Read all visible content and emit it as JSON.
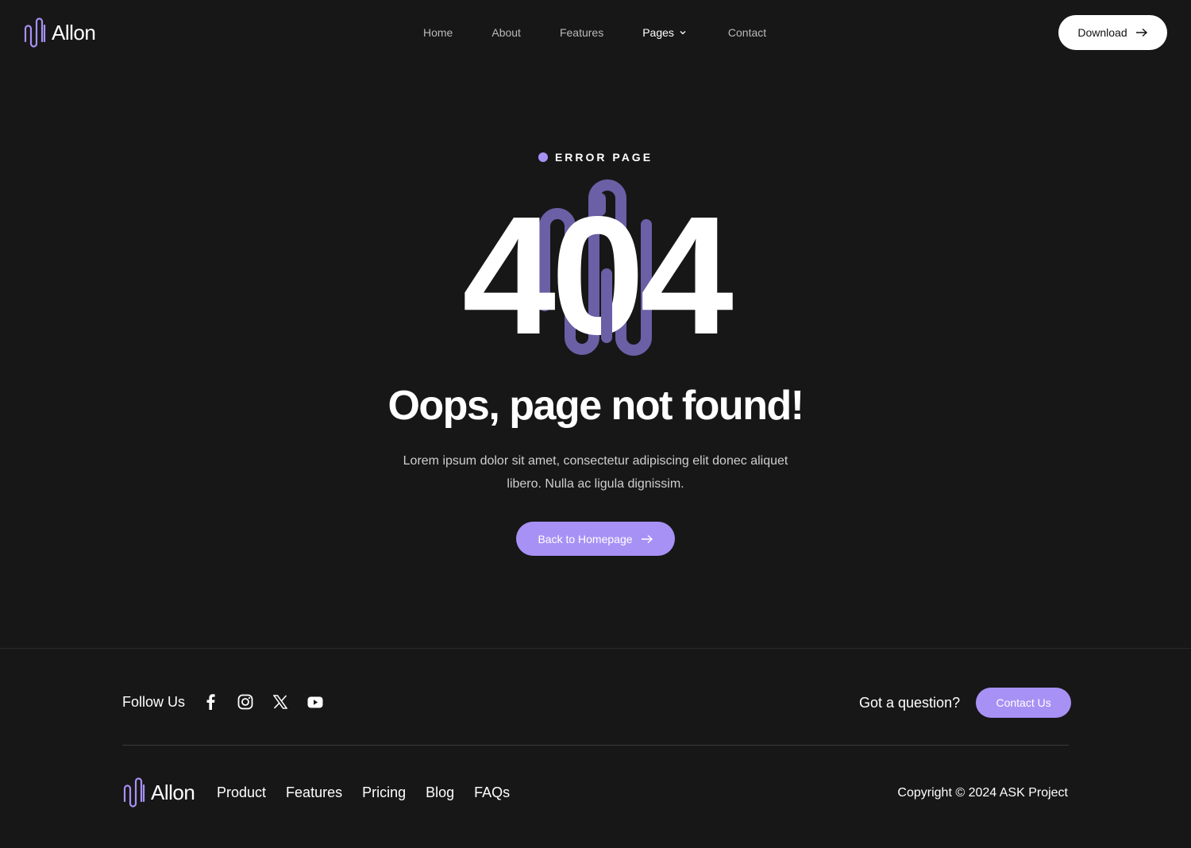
{
  "brand": {
    "name": "Allon",
    "logo_icon": "wave-logo-icon",
    "accent": "#a891f5"
  },
  "header": {
    "nav": [
      {
        "label": "Home"
      },
      {
        "label": "About"
      },
      {
        "label": "Features"
      },
      {
        "label": "Pages",
        "icon": "chevron-down-icon"
      },
      {
        "label": "Contact"
      }
    ],
    "download_label": "Download"
  },
  "hero": {
    "eyebrow": "ERROR PAGE",
    "code": "404",
    "headline": "Oops, page not found!",
    "description": "Lorem ipsum dolor sit amet, consectetur adipiscing elit donec aliquet libero. Nulla ac ligula dignissim.",
    "cta_label": "Back to Homepage"
  },
  "footer": {
    "follow_label": "Follow Us",
    "social_icons": [
      "facebook-icon",
      "instagram-icon",
      "x-icon",
      "youtube-icon"
    ],
    "question_label": "Got a question?",
    "contact_label": "Contact Us",
    "links": [
      "Product",
      "Features",
      "Pricing",
      "Blog",
      "FAQs"
    ],
    "copyright": "Copyright © 2024 ASK Project"
  },
  "colors": {
    "background": "#171717",
    "accent": "#a891f5",
    "wave_behind_404": "#6b5fa6"
  }
}
